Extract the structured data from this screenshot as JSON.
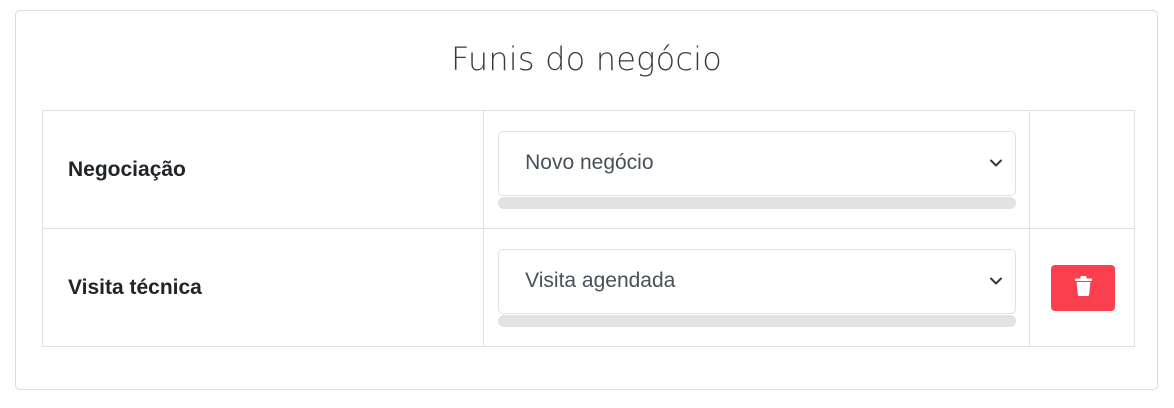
{
  "card": {
    "title": "Funis do negócio"
  },
  "funnels": [
    {
      "name": "Negociação",
      "stage": "Novo negócio",
      "progress": 0,
      "deletable": false
    },
    {
      "name": "Visita técnica",
      "stage": "Visita agendada",
      "progress": 0,
      "deletable": true
    }
  ],
  "icons": {
    "select_arrow": "chevron-down-icon",
    "delete": "trash-icon"
  },
  "colors": {
    "delete_button": "#fa3f4f",
    "progress_track": "#e2e2e2",
    "border": "#e0e0e0"
  }
}
